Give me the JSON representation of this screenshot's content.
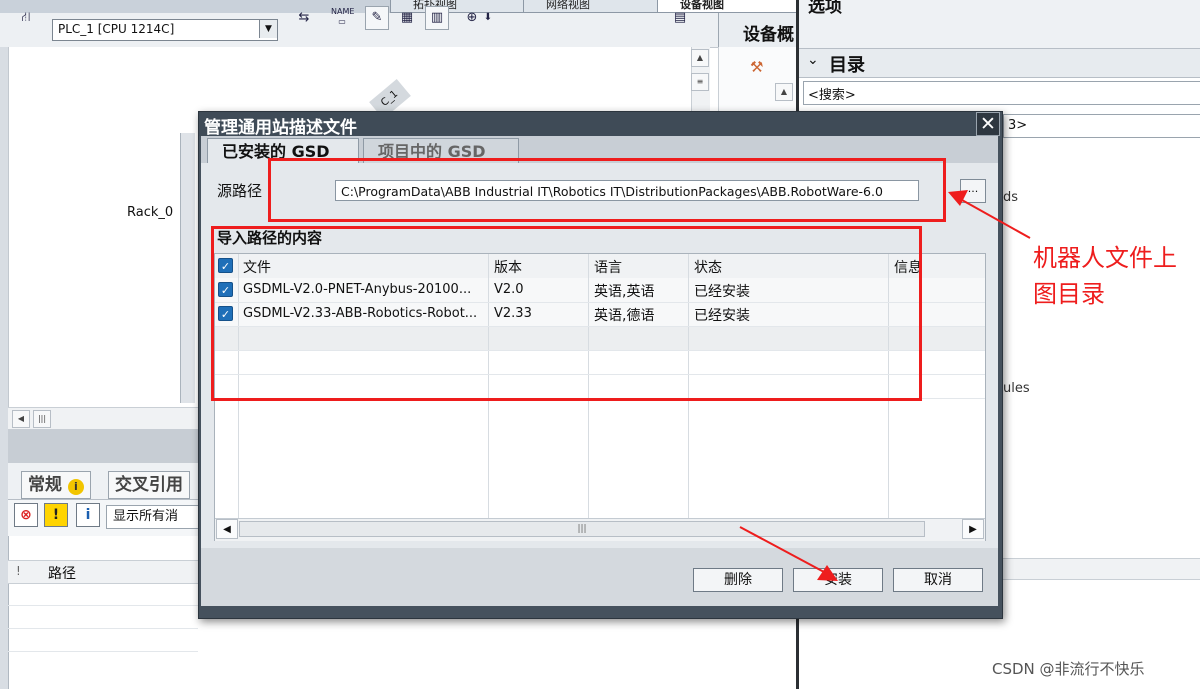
{
  "top_tabs": [
    "拓扑视图",
    "网络视图",
    "设备视图"
  ],
  "toolbar": {
    "device_selected": "PLC_1 [CPU 1214C]"
  },
  "canvas": {
    "rack_label": "Rack_0",
    "module_label": "C_1"
  },
  "device_overview": {
    "label": "设备概"
  },
  "right_pane": {
    "top_label": "选项",
    "catalog_title": "目录",
    "search_placeholder": "<搜索>",
    "filter_value": "3>",
    "item_ds": "ds",
    "item_ules": "ules"
  },
  "inspector": {
    "tabs": [
      "常规",
      "交叉引用"
    ],
    "show_messages": "显示所有消",
    "path_header": "路径",
    "col_marker": "!"
  },
  "dialog": {
    "title": "管理通用站描述文件",
    "close": "✕",
    "tabs": [
      {
        "label": "已安装的 GSD",
        "active": true
      },
      {
        "label": "项目中的 GSD",
        "active": false
      }
    ],
    "source_path_label": "源路径",
    "source_path": "C:\\ProgramData\\ABB Industrial IT\\Robotics IT\\DistributionPackages\\ABB.RobotWare-6.0",
    "browse_label": "...",
    "content_title": "导入路径的内容",
    "columns": [
      "文件",
      "版本",
      "语言",
      "状态",
      "信息"
    ],
    "rows": [
      {
        "checked": true,
        "file": "GSDML-V2.0-PNET-Anybus-20100...",
        "version": "V2.0",
        "language": "英语,英语",
        "status": "已经安装",
        "info": ""
      },
      {
        "checked": true,
        "file": "GSDML-V2.33-ABB-Robotics-Robot...",
        "version": "V2.33",
        "language": "英语,德语",
        "status": "已经安装",
        "info": ""
      }
    ],
    "buttons": {
      "delete": "删除",
      "install": "安装",
      "cancel": "取消"
    }
  },
  "annotation": {
    "line1": "机器人文件上",
    "line2": "图目录",
    "color": "#ee1d1d"
  },
  "watermark": "CSDN @非流行不快乐"
}
